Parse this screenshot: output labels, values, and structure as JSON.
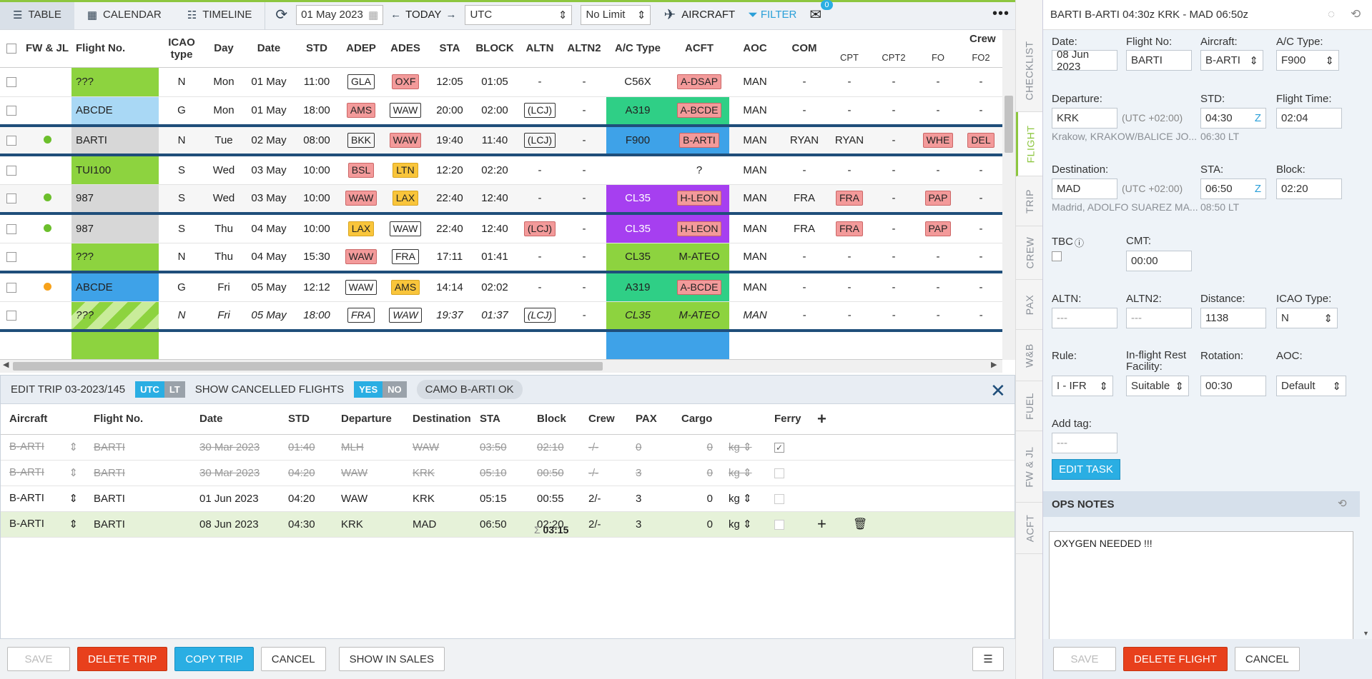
{
  "toolbar": {
    "view_table": "TABLE",
    "view_calendar": "CALENDAR",
    "view_timeline": "TIMELINE",
    "date": "01 May 2023",
    "today": "TODAY",
    "timezone": "UTC",
    "limit": "No Limit",
    "aircraft": "AIRCRAFT",
    "filter": "FILTER",
    "mail_count": "0"
  },
  "grid": {
    "headers": [
      "FW & JL",
      "Flight No.",
      "ICAO type",
      "Day",
      "Date",
      "STD",
      "ADEP",
      "ADES",
      "STA",
      "BLOCK",
      "ALTN",
      "ALTN2",
      "A/C Type",
      "ACFT",
      "AOC",
      "COM",
      "CPT",
      "CPT2",
      "FO",
      "FO2"
    ],
    "crew_label": "Crew",
    "rows": [
      {
        "fw": "",
        "flight": "???",
        "icao": "N",
        "day": "Mon",
        "date": "01 May",
        "std": "11:00",
        "adep": "GLA",
        "ades": "OXF",
        "sta": "12:05",
        "block": "01:05",
        "altn": "-",
        "altn2": "-",
        "actype": "C56X",
        "acft": "A-DSAP",
        "aoc": "MAN",
        "com": "-",
        "cpt": "-",
        "cpt2": "-",
        "fo": "-",
        "fo2": "-"
      },
      {
        "fw": "",
        "flight": "ABCDE",
        "icao": "G",
        "day": "Mon",
        "date": "01 May",
        "std": "18:00",
        "adep": "AMS",
        "ades": "WAW",
        "sta": "20:00",
        "block": "02:00",
        "altn": "(LCJ)",
        "altn2": "-",
        "actype": "A319",
        "acft": "A-BCDE",
        "aoc": "MAN",
        "com": "-",
        "cpt": "-",
        "cpt2": "-",
        "fo": "-",
        "fo2": "-"
      },
      {
        "fw": "",
        "flight": "BARTI",
        "icao": "N",
        "day": "Tue",
        "date": "02 May",
        "std": "08:00",
        "adep": "BKK",
        "ades": "WAW",
        "sta": "19:40",
        "block": "11:40",
        "altn": "(LCJ)",
        "altn2": "-",
        "actype": "F900",
        "acft": "B-ARTI",
        "aoc": "MAN",
        "com": "RYAN",
        "cpt": "RYAN",
        "cpt2": "-",
        "fo": "WHE",
        "fo2": "DEL"
      },
      {
        "fw": "",
        "flight": "TUI100",
        "icao": "S",
        "day": "Wed",
        "date": "03 May",
        "std": "10:00",
        "adep": "BSL",
        "ades": "LTN",
        "sta": "12:20",
        "block": "02:20",
        "altn": "-",
        "altn2": "-",
        "actype": "",
        "acft": "?",
        "aoc": "MAN",
        "com": "-",
        "cpt": "-",
        "cpt2": "-",
        "fo": "-",
        "fo2": "-"
      },
      {
        "fw": "",
        "flight": "987",
        "icao": "S",
        "day": "Wed",
        "date": "03 May",
        "std": "10:00",
        "adep": "WAW",
        "ades": "LAX",
        "sta": "22:40",
        "block": "12:40",
        "altn": "-",
        "altn2": "-",
        "actype": "CL35",
        "acft": "H-LEON",
        "aoc": "MAN",
        "com": "FRA",
        "cpt": "FRA",
        "cpt2": "-",
        "fo": "PAP",
        "fo2": "-"
      },
      {
        "fw": "",
        "flight": "987",
        "icao": "S",
        "day": "Thu",
        "date": "04 May",
        "std": "10:00",
        "adep": "LAX",
        "ades": "WAW",
        "sta": "22:40",
        "block": "12:40",
        "altn": "(LCJ)",
        "altn2": "-",
        "actype": "CL35",
        "acft": "H-LEON",
        "aoc": "MAN",
        "com": "FRA",
        "cpt": "FRA",
        "cpt2": "-",
        "fo": "PAP",
        "fo2": "-"
      },
      {
        "fw": "",
        "flight": "???",
        "icao": "N",
        "day": "Thu",
        "date": "04 May",
        "std": "15:30",
        "adep": "WAW",
        "ades": "FRA",
        "sta": "17:11",
        "block": "01:41",
        "altn": "-",
        "altn2": "-",
        "actype": "CL35",
        "acft": "M-ATEO",
        "aoc": "MAN",
        "com": "-",
        "cpt": "-",
        "cpt2": "-",
        "fo": "-",
        "fo2": "-"
      },
      {
        "fw": "",
        "flight": "ABCDE",
        "icao": "G",
        "day": "Fri",
        "date": "05 May",
        "std": "12:12",
        "adep": "WAW",
        "ades": "AMS",
        "sta": "14:14",
        "block": "02:02",
        "altn": "-",
        "altn2": "-",
        "actype": "A319",
        "acft": "A-BCDE",
        "aoc": "MAN",
        "com": "-",
        "cpt": "-",
        "cpt2": "-",
        "fo": "-",
        "fo2": "-"
      },
      {
        "fw": "",
        "flight": "???",
        "icao": "N",
        "day": "Fri",
        "date": "05 May",
        "std": "18:00",
        "adep": "FRA",
        "ades": "WAW",
        "sta": "19:37",
        "block": "01:37",
        "altn": "(LCJ)",
        "altn2": "-",
        "actype": "CL35",
        "acft": "M-ATEO",
        "aoc": "MAN",
        "com": "-",
        "cpt": "-",
        "cpt2": "-",
        "fo": "-",
        "fo2": "-"
      }
    ]
  },
  "trip": {
    "title": "EDIT TRIP 03-2023/145",
    "utc": "UTC",
    "lt": "LT",
    "show_cancelled": "SHOW CANCELLED FLIGHTS",
    "yes": "YES",
    "no": "NO",
    "camo": "CAMO B-ARTI OK",
    "headers": [
      "Aircraft",
      "Flight No.",
      "Date",
      "STD",
      "Departure",
      "Destination",
      "STA",
      "Block",
      "Crew",
      "PAX",
      "Cargo",
      "Ferry"
    ],
    "rows": [
      {
        "aircraft": "B-ARTI",
        "flight": "BARTI",
        "date": "30 Mar 2023",
        "std": "01:40",
        "dep": "MLH",
        "dest": "WAW",
        "sta": "03:50",
        "block": "02:10",
        "crew": "-/-",
        "pax": "0",
        "cargo": "0",
        "unit": "kg"
      },
      {
        "aircraft": "B-ARTI",
        "flight": "BARTI",
        "date": "30 Mar 2023",
        "std": "04:20",
        "dep": "WAW",
        "dest": "KRK",
        "sta": "05:10",
        "block": "00:50",
        "crew": "-/-",
        "pax": "3",
        "cargo": "0",
        "unit": "kg"
      },
      {
        "aircraft": "B-ARTI",
        "flight": "BARTI",
        "date": "01 Jun 2023",
        "std": "04:20",
        "dep": "WAW",
        "dest": "KRK",
        "sta": "05:15",
        "block": "00:55",
        "crew": "2/-",
        "pax": "3",
        "cargo": "0",
        "unit": "kg"
      },
      {
        "aircraft": "B-ARTI",
        "flight": "BARTI",
        "date": "08 Jun 2023",
        "std": "04:30",
        "dep": "KRK",
        "dest": "MAD",
        "sta": "06:50",
        "block": "02:20",
        "crew": "2/-",
        "pax": "3",
        "cargo": "0",
        "unit": "kg"
      }
    ],
    "total": "03:15"
  },
  "bottom": {
    "save": "SAVE",
    "delete_trip": "DELETE TRIP",
    "copy_trip": "COPY TRIP",
    "cancel": "CANCEL",
    "show_in_sales": "SHOW IN SALES"
  },
  "vtabs": [
    "CHECKLIST",
    "FLIGHT",
    "TRIP",
    "CREW",
    "PAX",
    "W&B",
    "FUEL",
    "FW & JL",
    "ACFT"
  ],
  "panel": {
    "title": "BARTI B-ARTI 04:30z KRK - MAD 06:50z",
    "date_label": "Date:",
    "date": "08 Jun 2023",
    "flightno_label": "Flight No:",
    "flightno": "BARTI",
    "aircraft_label": "Aircraft:",
    "aircraft": "B-ARTI",
    "actype_label": "A/C Type:",
    "actype": "F900",
    "departure_label": "Departure:",
    "departure": "KRK",
    "dep_tz": "(UTC +02:00)",
    "dep_name": "Krakow, KRAKOW/BALICE JO...",
    "std_label": "STD:",
    "std": "04:30",
    "std_z": "Z",
    "std_lt": "06:30 LT",
    "flighttime_label": "Flight Time:",
    "flighttime": "02:04",
    "destination_label": "Destination:",
    "destination": "MAD",
    "dest_tz": "(UTC +02:00)",
    "dest_name": "Madrid, ADOLFO SUAREZ MA...",
    "sta_label": "STA:",
    "sta": "06:50",
    "sta_z": "Z",
    "sta_lt": "08:50 LT",
    "block_label": "Block:",
    "block": "02:20",
    "tbc_label": "TBC",
    "cmt_label": "CMT:",
    "cmt": "00:00",
    "altn_label": "ALTN:",
    "altn": "---",
    "altn2_label": "ALTN2:",
    "altn2": "---",
    "distance_label": "Distance:",
    "distance": "1138",
    "icao_label": "ICAO Type:",
    "icao": "N",
    "rule_label": "Rule:",
    "rule": "I - IFR",
    "rest_label": "In-flight Rest Facility:",
    "rest": "Suitable",
    "rotation_label": "Rotation:",
    "rotation": "00:30",
    "aoc_label": "AOC:",
    "aoc": "Default",
    "tag_label": "Add tag:",
    "tag": "---",
    "edit_task": "EDIT TASK",
    "ops_notes": "OPS NOTES",
    "notes": "OXYGEN NEEDED !!!",
    "save": "SAVE",
    "delete_flight": "DELETE FLIGHT",
    "cancel": "CANCEL"
  }
}
